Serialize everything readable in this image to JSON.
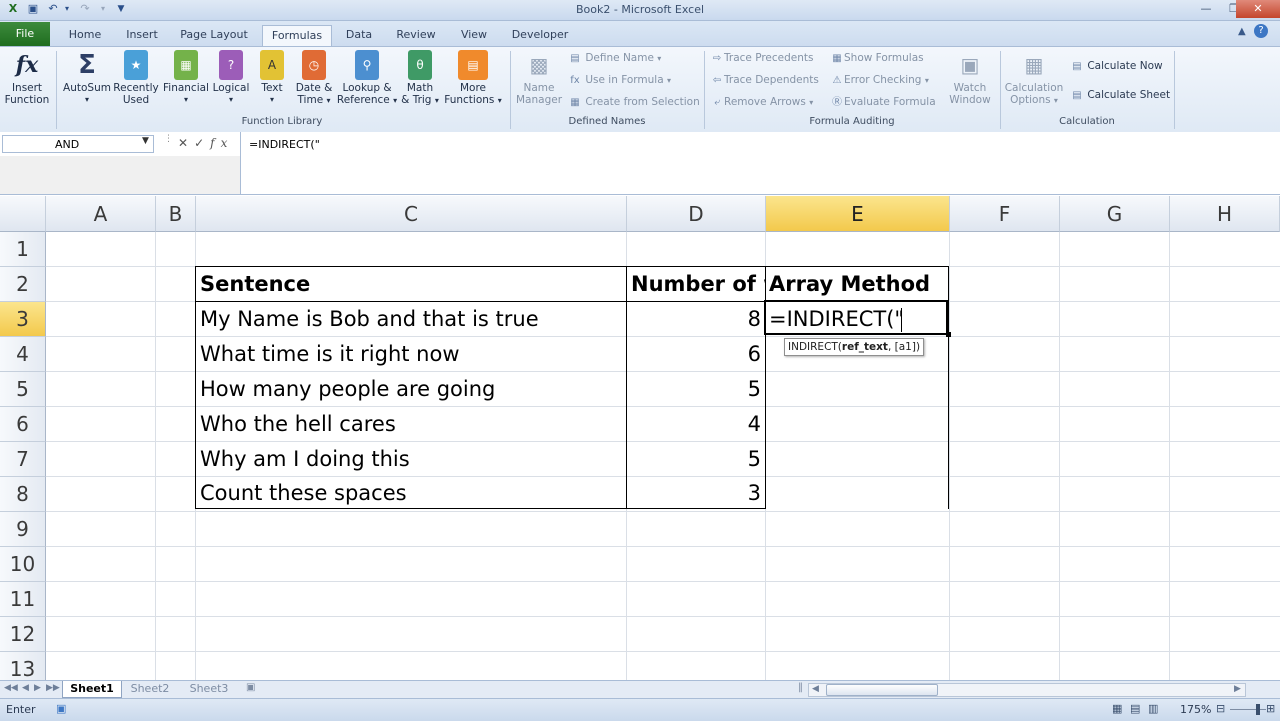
{
  "window": {
    "title": "Book2 - Microsoft Excel"
  },
  "tabs": [
    "File",
    "Home",
    "Insert",
    "Page Layout",
    "Formulas",
    "Data",
    "Review",
    "View",
    "Developer"
  ],
  "active_tab": "Formulas",
  "ribbon": {
    "function_library": {
      "label": "Function Library",
      "insert_function": [
        "Insert",
        "Function"
      ],
      "buttons": [
        {
          "l1": "AutoSum",
          "l2": "",
          "icon": "sigma-icon",
          "color": "#2d3f66"
        },
        {
          "l1": "Recently",
          "l2": "Used",
          "icon": "book-star-icon",
          "color": "#4aa0d8"
        },
        {
          "l1": "Financial",
          "l2": "",
          "icon": "book-finance-icon",
          "color": "#74b24a"
        },
        {
          "l1": "Logical",
          "l2": "",
          "icon": "book-question-icon",
          "color": "#9c5db8"
        },
        {
          "l1": "Text",
          "l2": "",
          "icon": "book-text-icon",
          "color": "#e2c234"
        },
        {
          "l1": "Date &",
          "l2": "Time",
          "icon": "book-clock-icon",
          "color": "#e06b35"
        },
        {
          "l1": "Lookup &",
          "l2": "Reference",
          "icon": "book-lookup-icon",
          "color": "#4c8fd0"
        },
        {
          "l1": "Math",
          "l2": "& Trig",
          "icon": "book-theta-icon",
          "color": "#3f9a66"
        },
        {
          "l1": "More",
          "l2": "Functions",
          "icon": "books-icon",
          "color": "#f08a2c"
        }
      ]
    },
    "defined_names": {
      "label": "Defined Names",
      "name_manager": [
        "Name",
        "Manager"
      ],
      "define_name": "Define Name",
      "use_in_formula": "Use in Formula",
      "create_from_selection": "Create from Selection"
    },
    "formula_auditing": {
      "label": "Formula Auditing",
      "trace_precedents": "Trace Precedents",
      "trace_dependents": "Trace Dependents",
      "remove_arrows": "Remove Arrows",
      "show_formulas": "Show Formulas",
      "error_checking": "Error Checking",
      "evaluate_formula": "Evaluate Formula",
      "watch_window": [
        "Watch",
        "Window"
      ]
    },
    "calculation": {
      "label": "Calculation",
      "calculation_options": [
        "Calculation",
        "Options"
      ],
      "calculate_now": "Calculate Now",
      "calculate_sheet": "Calculate Sheet"
    }
  },
  "formula_bar": {
    "name_box": "AND",
    "formula": "=INDIRECT(\""
  },
  "grid": {
    "columns": [
      "A",
      "B",
      "C",
      "D",
      "E",
      "F",
      "G",
      "H"
    ],
    "rows": [
      "1",
      "2",
      "3",
      "4",
      "5",
      "6",
      "7",
      "8",
      "9",
      "10",
      "11",
      "12",
      "13"
    ],
    "selected_column": "E",
    "selected_row": "3",
    "headers": {
      "sentence": "Sentence",
      "number_of_words": "Number of w",
      "array_method": "Array Method"
    },
    "data": [
      {
        "sentence": "My Name is Bob and that is true",
        "count": "8"
      },
      {
        "sentence": "What time is it right now",
        "count": "6"
      },
      {
        "sentence": "How many people are going",
        "count": "5"
      },
      {
        "sentence": "Who the hell cares",
        "count": "4"
      },
      {
        "sentence": "Why am I doing this",
        "count": "5"
      },
      {
        "sentence": "Count these spaces",
        "count": "3"
      }
    ],
    "editing_cell": "=INDIRECT(\"",
    "tooltip": {
      "func": "INDIRECT(",
      "arg_bold": "ref_text",
      "rest": ", [a1])"
    }
  },
  "sheets": [
    "Sheet1",
    "Sheet2",
    "Sheet3"
  ],
  "active_sheet": "Sheet1",
  "status": {
    "mode": "Enter",
    "zoom": "175%"
  }
}
